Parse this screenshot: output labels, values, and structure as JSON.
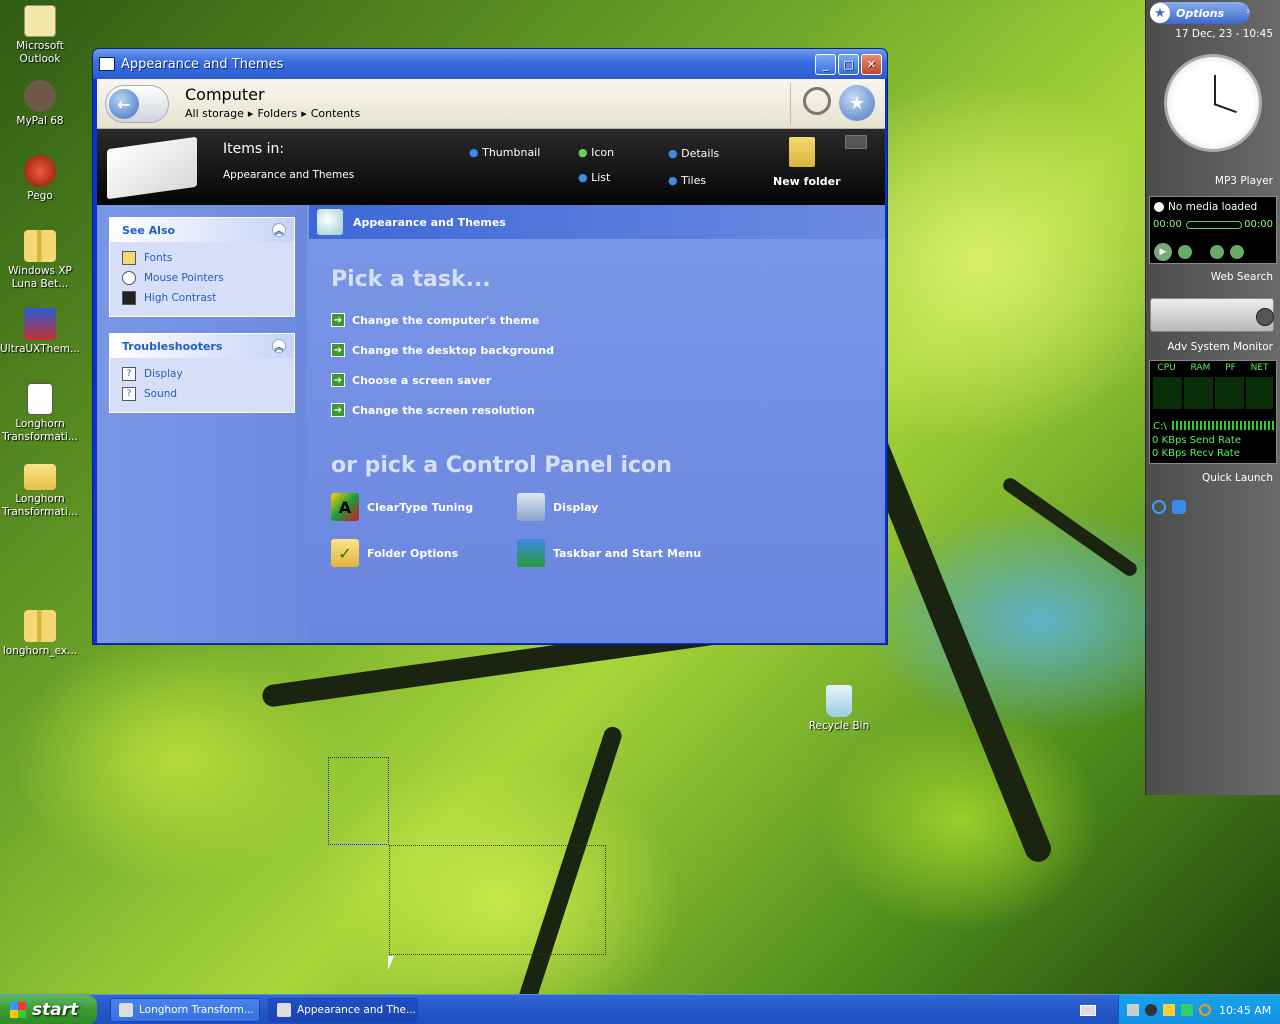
{
  "desktop": {
    "icons": [
      {
        "label": "Microsoft Outlook",
        "icon": "outlook-icon"
      },
      {
        "label": "MyPal 68",
        "icon": "browser-icon"
      },
      {
        "label": "Pego",
        "icon": "app-icon"
      },
      {
        "label": "Windows XP Luna Bet...",
        "icon": "zip-folder-icon"
      },
      {
        "label": "UltraUXThem...",
        "icon": "app-icon"
      },
      {
        "label": "Longhorn Transformati...",
        "icon": "document-icon"
      },
      {
        "label": "Longhorn Transformati...",
        "icon": "folder-icon"
      },
      {
        "label": "longhorn_ex...",
        "icon": "zip-folder-icon"
      }
    ],
    "recycle_bin": "Recycle Bin"
  },
  "window": {
    "title": "Appearance and Themes",
    "address": {
      "heading": "Computer",
      "crumbs": [
        "All storage",
        "Folders",
        "Contents"
      ]
    },
    "band": {
      "items_in_label": "Items in:",
      "items_in_value": "Appearance and Themes",
      "views": [
        "Thumbnail",
        "Icon",
        "Details",
        "List",
        "Tiles"
      ],
      "new_folder": "New folder"
    },
    "see_also": {
      "title": "See Also",
      "items": [
        "Fonts",
        "Mouse Pointers",
        "High Contrast"
      ]
    },
    "troubleshooters": {
      "title": "Troubleshooters",
      "items": [
        "Display",
        "Sound"
      ]
    },
    "main": {
      "header": "Appearance and Themes",
      "pick_task": "Pick a task...",
      "tasks": [
        "Change the computer's theme",
        "Change the desktop background",
        "Choose a screen saver",
        "Change the screen resolution"
      ],
      "pick_icon": "or pick a Control Panel icon",
      "icons": [
        "ClearType Tuning",
        "Display",
        "Folder Options",
        "Taskbar and Start Menu"
      ]
    }
  },
  "sidebar": {
    "options": "Options",
    "datetime": "17 Dec, 23 - 10:45",
    "mp3_title": "MP3 Player",
    "mp3_status": "No media loaded",
    "mp3_time_left": "00:00",
    "mp3_time_right": "00:00",
    "web_search": "Web Search",
    "sysmon_title": "Adv System Monitor",
    "sysmon_cols": [
      "CPU",
      "RAM",
      "PF",
      "NET"
    ],
    "drive": "C:\\",
    "send_rate": "0 KBps Send Rate",
    "recv_rate": "0 KBps Recv Rate",
    "quick_launch": "Quick Launch"
  },
  "taskbar": {
    "start": "start",
    "items": [
      "Longhorn Transform...",
      "Appearance and The..."
    ],
    "clock": "10:45 AM"
  }
}
